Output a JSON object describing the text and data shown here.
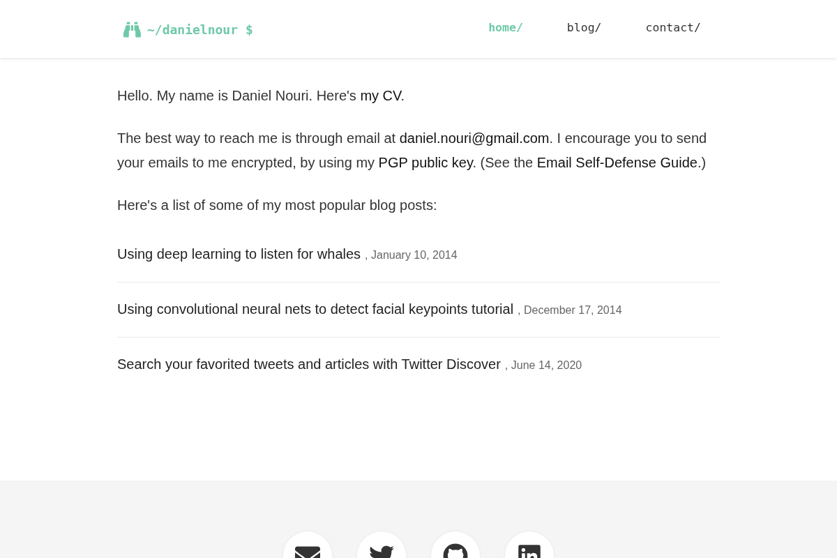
{
  "header": {
    "logo": {
      "text": "~/danielnour $"
    },
    "nav": [
      {
        "label": "home/",
        "selected": true
      },
      {
        "label": "blog/",
        "selected": false
      },
      {
        "label": "contact/",
        "selected": false
      }
    ]
  },
  "intro": [
    [
      {
        "kind": "text",
        "text": "Hello. My name is Daniel Nouri. Here's "
      },
      {
        "kind": "link",
        "text": "my CV"
      },
      {
        "kind": "text",
        "text": "."
      }
    ],
    [
      {
        "kind": "text",
        "text": "The best way to reach me is through email at "
      },
      {
        "kind": "link",
        "text": "daniel.nouri@gmail.com"
      },
      {
        "kind": "text",
        "text": ". I encourage you to send your emails to me encrypted, by using my "
      },
      {
        "kind": "link",
        "text": "PGP public key"
      },
      {
        "kind": "text",
        "text": ". (See the "
      },
      {
        "kind": "link",
        "text": "Email Self-Defense Guide"
      },
      {
        "kind": "text",
        "text": ".)"
      }
    ],
    [
      {
        "kind": "text",
        "text": "Here's a list of some of my most popular blog posts:"
      }
    ]
  ],
  "posts": [
    {
      "title": "Using deep learning to listen for whales",
      "date": ", January 10, 2014"
    },
    {
      "title": "Using convolutional neural nets to detect facial keypoints tutorial",
      "date": ", December 17, 2014"
    },
    {
      "title": "Search your favorited tweets and articles with Twitter Discover",
      "date": ", June 14, 2020"
    }
  ],
  "footer": {
    "social_links": [
      {
        "kind": "email"
      },
      {
        "kind": "twitter"
      },
      {
        "kind": "github"
      },
      {
        "kind": "linkedin"
      }
    ]
  }
}
